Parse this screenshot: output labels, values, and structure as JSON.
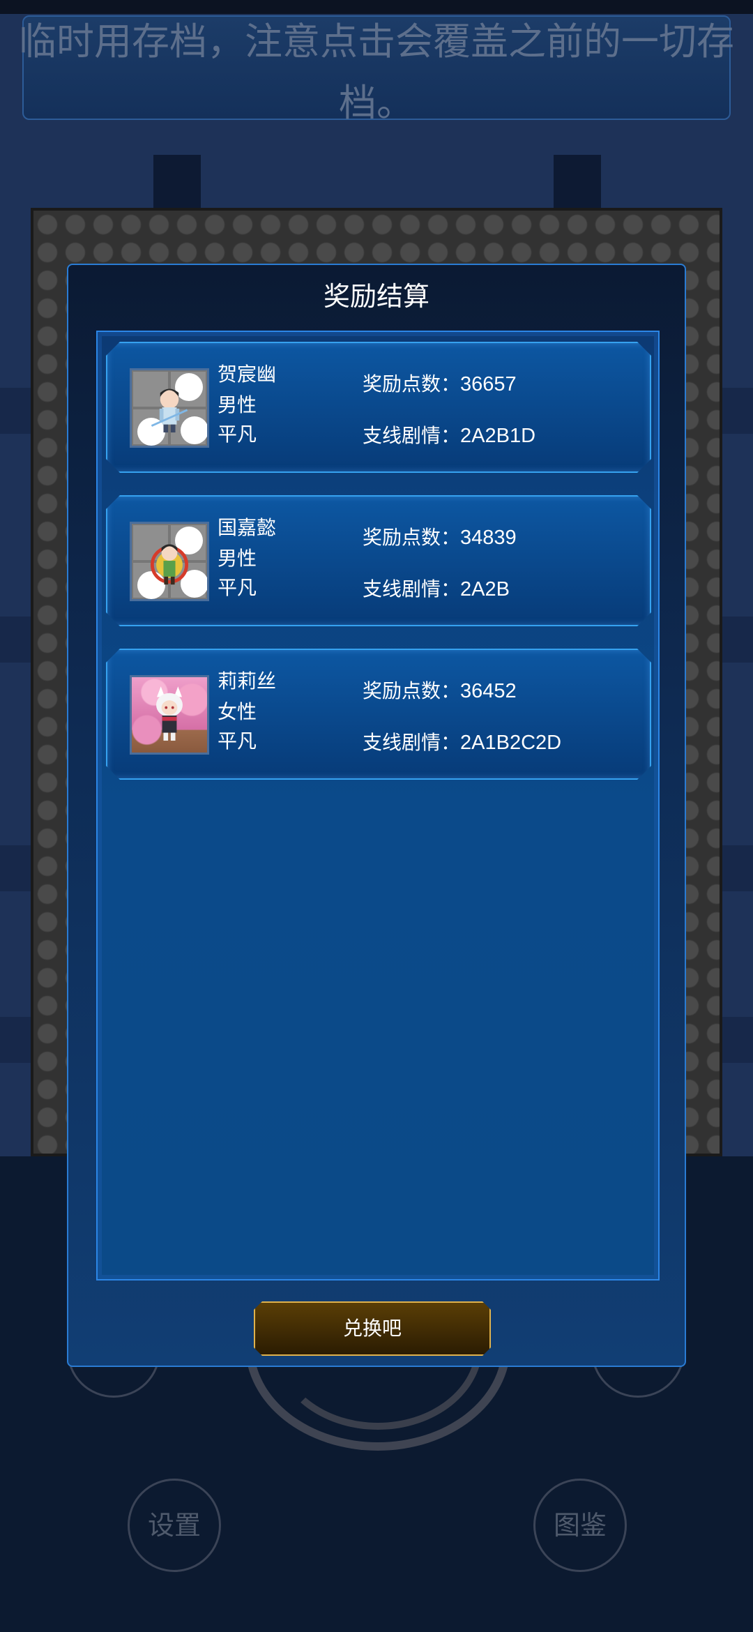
{
  "background": {
    "banner_line1": "临时用存档，注意点击会覆盖之前的一切存",
    "banner_line2": "档。",
    "settings_label": "设置",
    "codex_label": "图鉴"
  },
  "modal": {
    "title": "奖励结算",
    "points_label": "奖励点数：",
    "branch_label": "支线剧情：",
    "characters": [
      {
        "name": "贺宸幽",
        "gender": "男性",
        "rank": "平凡",
        "points": "36657",
        "branch": "2A2B1D"
      },
      {
        "name": "国嘉懿",
        "gender": "男性",
        "rank": "平凡",
        "points": "34839",
        "branch": "2A2B"
      },
      {
        "name": "莉莉丝",
        "gender": "女性",
        "rank": "平凡",
        "points": "36452",
        "branch": "2A1B2C2D"
      }
    ],
    "exchange_button": "兑换吧"
  },
  "colors": {
    "panel_blue": "#0b4a8a",
    "border_blue": "#2c86e6",
    "button_gold": "#e0b24c"
  }
}
